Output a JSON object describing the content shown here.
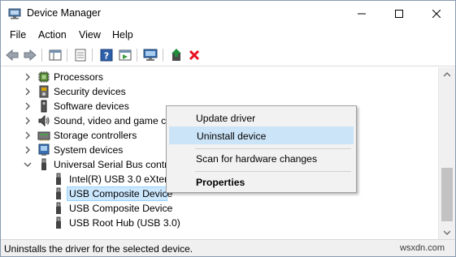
{
  "window": {
    "title": "Device Manager"
  },
  "menu": [
    "File",
    "Action",
    "View",
    "Help"
  ],
  "tree": [
    {
      "label": "Processors",
      "expand": "collapsed",
      "icon": "processor-icon"
    },
    {
      "label": "Security devices",
      "expand": "collapsed",
      "icon": "security-device-icon"
    },
    {
      "label": "Software devices",
      "expand": "collapsed",
      "icon": "software-device-icon"
    },
    {
      "label": "Sound, video and game co",
      "expand": "collapsed",
      "icon": "sound-icon"
    },
    {
      "label": "Storage controllers",
      "expand": "collapsed",
      "icon": "storage-controller-icon"
    },
    {
      "label": "System devices",
      "expand": "collapsed",
      "icon": "system-device-icon"
    },
    {
      "label": "Universal Serial Bus contro",
      "expand": "expanded",
      "icon": "usb-icon"
    },
    {
      "label": "Intel(R) USB 3.0 eXtensi",
      "expand": "none",
      "icon": "usb-plug-icon"
    },
    {
      "label": "USB Composite Device",
      "expand": "none",
      "icon": "usb-plug-icon",
      "selected": true
    },
    {
      "label": "USB Composite Device",
      "expand": "none",
      "icon": "usb-plug-icon"
    },
    {
      "label": "USB Root Hub (USB 3.0)",
      "expand": "none",
      "icon": "usb-plug-icon"
    }
  ],
  "context_menu": {
    "update": "Update driver",
    "uninstall": "Uninstall device",
    "scan": "Scan for hardware changes",
    "properties": "Properties"
  },
  "status": {
    "text": "Uninstalls the driver for the selected device."
  },
  "watermark": "wsxdn.com",
  "colors": {
    "selection": "#cce8ff",
    "menu_highlight": "#cce4f7",
    "delete_red": "#e81123",
    "update_green": "#1e8f3a"
  }
}
